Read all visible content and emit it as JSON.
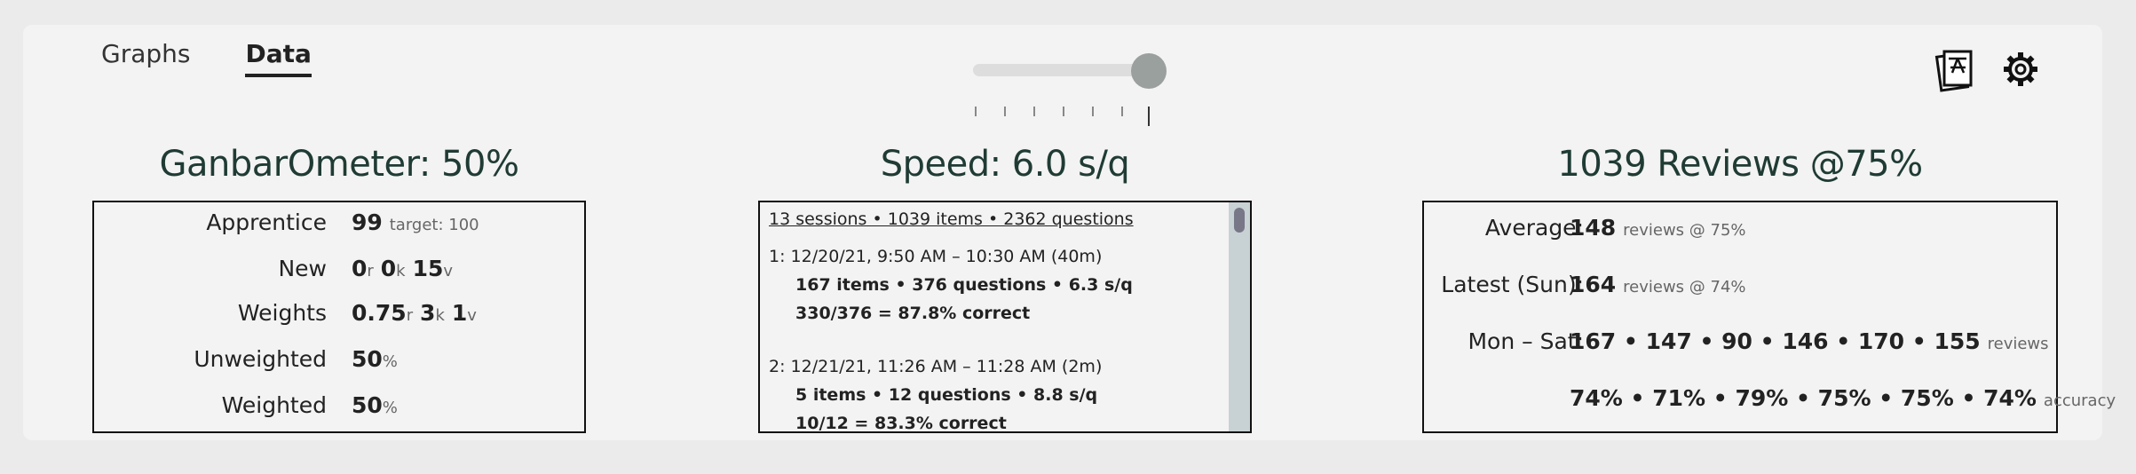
{
  "tabs": [
    {
      "label": "Graphs"
    },
    {
      "label": "Data"
    }
  ],
  "slider": {
    "value_fraction": 1.0,
    "ticks": 7
  },
  "icons": {
    "kanji_card": "kanji-card-icon",
    "settings": "gear-icon"
  },
  "ganbarometer": {
    "title": "GanbarOmeter: 50%",
    "apprentice": {
      "label": "Apprentice",
      "value": "99",
      "target": "target: 100"
    },
    "new": {
      "label": "New",
      "r": "0",
      "r_unit": "r",
      "k": "0",
      "k_unit": "k",
      "v": "15",
      "v_unit": "v"
    },
    "weights": {
      "label": "Weights",
      "r": "0.75",
      "r_unit": "r",
      "k": "3",
      "k_unit": "k",
      "v": "1",
      "v_unit": "v"
    },
    "unweighted": {
      "label": "Unweighted",
      "value": "50",
      "unit": "%"
    },
    "weighted": {
      "label": "Weighted",
      "value": "50",
      "unit": "%"
    }
  },
  "speed": {
    "title": "Speed: 6.0 s/q",
    "summary": "13 sessions • 1039 items • 2362 questions",
    "sessions": [
      {
        "header": "1: 12/20/21, 9:50 AM – 10:30 AM (40m)",
        "stats": "167 items • 376 questions • 6.3 s/q",
        "correct": "330/376 = 87.8% correct"
      },
      {
        "header": "2: 12/21/21, 11:26 AM – 11:28 AM (2m)",
        "stats": "5 items • 12 questions • 8.8 s/q",
        "correct": "10/12 = 83.3% correct"
      }
    ]
  },
  "reviews": {
    "title": "1039 Reviews @75%",
    "average": {
      "label": "Average:",
      "value": "148",
      "suffix": "reviews @ 75%"
    },
    "latest": {
      "label": "Latest (Sun):",
      "value": "164",
      "suffix": "reviews @ 74%"
    },
    "mon_sat": {
      "label": "Mon – Sat:",
      "values": "167 • 147 • 90 • 146 • 170 • 155",
      "suffix": "reviews"
    },
    "accuracy": {
      "values": "74% • 71% • 79% • 75% • 75% • 74%",
      "suffix": "accuracy"
    }
  }
}
